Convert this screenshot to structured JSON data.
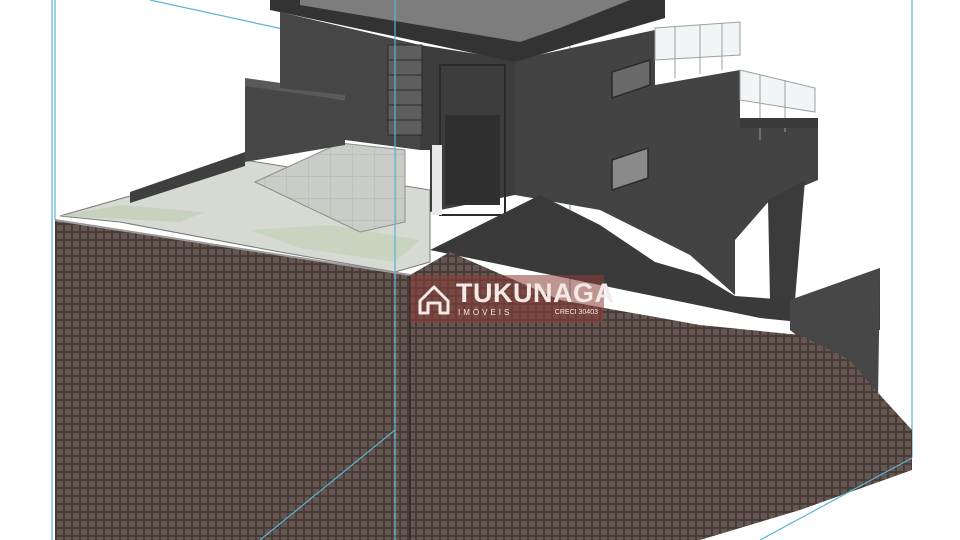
{
  "watermark": {
    "brand": "TUKUNAGA",
    "subtitle": "IMÓVEIS",
    "creci": "CRECI 30403"
  },
  "icons": [
    "house-logo-icon"
  ],
  "colors": {
    "soil_pattern": "#4a3d37",
    "building": "#404040",
    "ground_surface": "#d7d9d3",
    "bounding_lines": "#5ab4d6",
    "watermark_bg": "#8c3c37"
  }
}
